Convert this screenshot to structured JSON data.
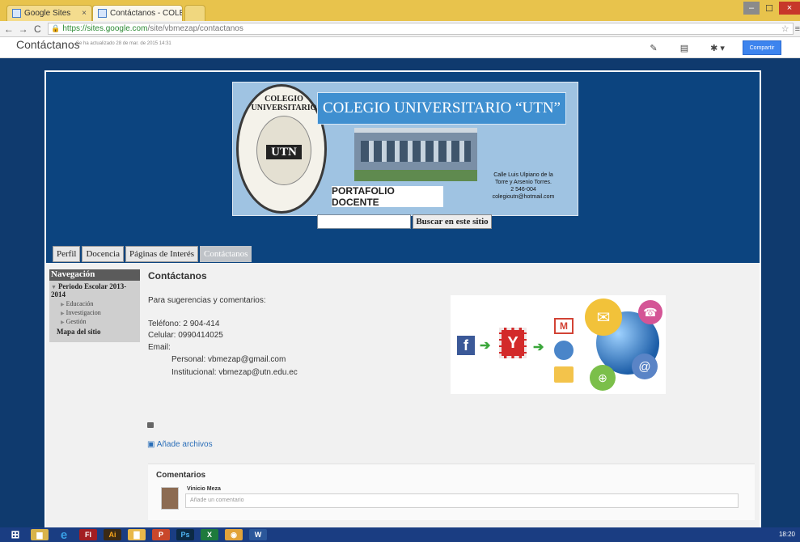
{
  "browser": {
    "tabs": [
      {
        "label": "Google Sites"
      },
      {
        "label": "Contáctanos - COLEGIO U"
      },
      {
        "label": ""
      }
    ],
    "url_host": "https://sites.google.com",
    "url_path": "/site/vbmezap/contactanos",
    "window_buttons": {
      "minimize": "–",
      "maximize": "☐",
      "close": "×"
    }
  },
  "sites_bar": {
    "page_title": "Contáctanos",
    "updated_note": "Se ha actualizado 28 de mar. de 2015 14:31",
    "share_label": "Compartir",
    "edit_icon": "pencil-icon",
    "page_icon": "new-page-icon",
    "gear_icon": "gear-icon"
  },
  "banner": {
    "title": "COLEGIO UNIVERSITARIO “UTN”",
    "seal_text": "COLEGIO UNIVERSITARIO",
    "seal_logo": "UTN",
    "portfolio": "PORTAFOLIO DOCENTE",
    "address_lines": [
      "Calle Luis Ulpiano de la",
      "Torre y Arsenio Torres.",
      "2 546-004",
      "colegioutn@hotmail.com"
    ]
  },
  "search": {
    "button_label": "Buscar en este sitio"
  },
  "nav_tabs": [
    {
      "label": "Perfil"
    },
    {
      "label": "Docencia"
    },
    {
      "label": "Páginas de Interés"
    },
    {
      "label": "Contáctanos"
    }
  ],
  "sidebar": {
    "heading": "Navegación",
    "section": "Periodo Escolar 2013-2014",
    "items": [
      "Educación",
      "Investigacion",
      "Gestión"
    ],
    "sitemap": "Mapa del sitio"
  },
  "content": {
    "title": "Contáctanos",
    "intro": "Para sugerencias y comentarios:",
    "phone": "Teléfono: 2 904-414",
    "mobile": "Celular: 0990414025",
    "email_label": "Email:",
    "personal": "Personal: vbmezap@gmail.com",
    "institutional": "Institucional: vbmezap@utn.edu.ec",
    "attach_label": "Añade archivos"
  },
  "comments": {
    "title": "Comentarios",
    "author": "Vinicio Meza",
    "placeholder": "Añade un comentario"
  },
  "taskbar": {
    "apps": [
      "Windows",
      "Explorer",
      "Internet Explorer",
      "Flash",
      "Illustrator",
      "Folder",
      "PowerPoint",
      "Photoshop",
      "Excel",
      "Chrome",
      "Word"
    ],
    "clock_time": "18:20"
  },
  "colors": {
    "site_header": "#0c447f",
    "share_button": "#3d84ee",
    "tabstrip": "#e8c34c"
  }
}
